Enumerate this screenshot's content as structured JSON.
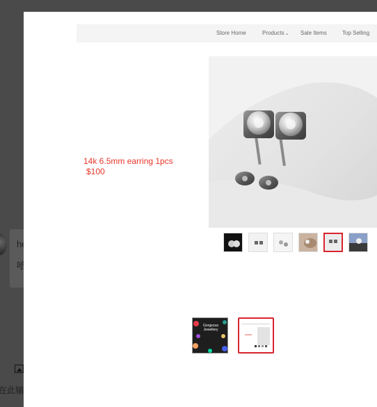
{
  "backdrop": {
    "sender_name": "he",
    "message_snippet": "哈",
    "input_hint": "在此输"
  },
  "store_nav": {
    "items": [
      {
        "label": "Store Home"
      },
      {
        "label": "Products",
        "has_dropdown": true
      },
      {
        "label": "Sale Items"
      },
      {
        "label": "Top Selling"
      }
    ]
  },
  "product": {
    "title": "14k  6.5mm earring 1pcs",
    "price": "$100"
  },
  "gallery": {
    "thumbnail_count": 6,
    "active_thumbnail_index": 4
  },
  "attachments": {
    "items": [
      {
        "caption": "Gorgeous Jewellery"
      },
      {
        "caption": ""
      }
    ],
    "active_index": 1
  },
  "colors": {
    "accent_red": "#d9232d",
    "product_text": "#e8362a",
    "overlay": "#4a4a4a"
  }
}
